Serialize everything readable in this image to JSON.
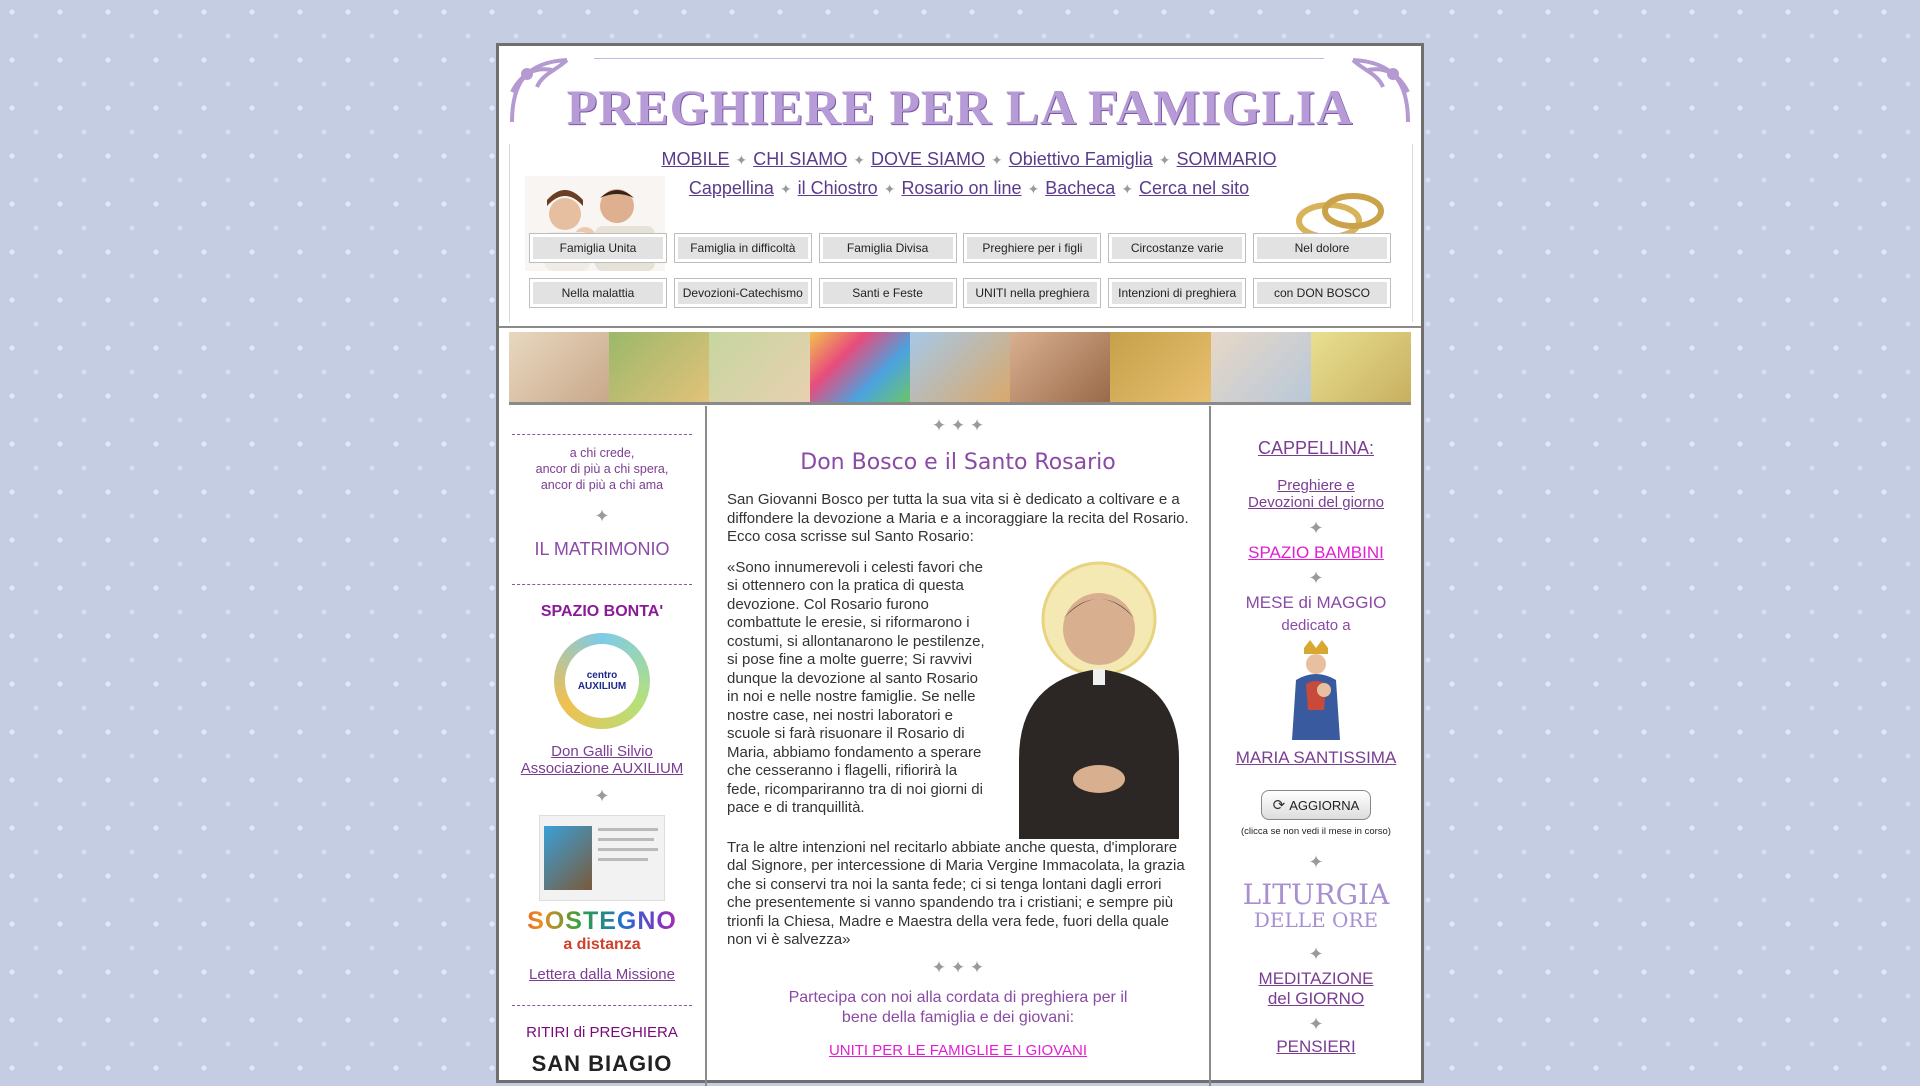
{
  "header": {
    "title": "PREGHIERE PER LA FAMIGLIA",
    "nav_row1": [
      "MOBILE",
      "CHI SIAMO",
      "DOVE SIAMO",
      "Obiettivo Famiglia",
      "SOMMARIO"
    ],
    "nav_row2": [
      "Cappellina",
      "il Chiostro",
      "Rosario on line",
      "Bacheca",
      "Cerca nel sito"
    ],
    "buttons_row1": [
      "Famiglia Unita",
      "Famiglia in difficoltà",
      "Famiglia Divisa",
      "Preghiere per i figli",
      "Circostanze varie",
      "Nel dolore"
    ],
    "buttons_row2": [
      "Nella malattia",
      "Devozioni-Catechismo",
      "Santi e Feste",
      "UNITI nella preghiera",
      "Intenzioni di preghiera",
      "con DON BOSCO"
    ]
  },
  "left": {
    "quote": [
      "a chi crede,",
      "ancor di più a chi spera,",
      "ancor di più a chi ama"
    ],
    "matrimonio": "IL MATRIMONIO",
    "spazio_bonta": "SPAZIO BONTA'",
    "auxilium_logo_text": [
      "centro",
      "AUXILIUM"
    ],
    "auxilium_link": [
      "Don Galli Silvio",
      "Associazione AUXILIUM"
    ],
    "sostegno": "SOSTEGNO",
    "distanza": "a distanza",
    "lettera": "Lettera dalla Missione",
    "ritiri": "RITIRI di PREGHIERA",
    "san_biagio": "SAN BIAGIO"
  },
  "center": {
    "stars": "✦ ✦ ✦",
    "title": "Don Bosco e il Santo Rosario",
    "intro": "San Giovanni Bosco per tutta la sua vita si è dedicato a coltivare e a diffondere la devozione a Maria e a incoraggiare la recita del Rosario. Ecco cosa scrisse sul Santo Rosario:",
    "quote_part1": "«Sono innumerevoli i celesti favori che si ottennero con la pratica di questa devozione. Col Rosario furono combattute le eresie, si riformarono i costumi, si allontanarono le pestilenze, si pose fine a molte guerre; Si ravvivi dunque la devozione al santo Rosario in noi e nelle nostre famiglie. Se nelle nostre case, nei nostri laboratori e scuole si farà risuonare il Rosario di Maria, abbiamo fondamento a sperare che cesseranno i flagelli, rifiorirà la fede, ricompariranno tra di noi giorni di pace e di tranquillità.",
    "quote_part2": "Tra le altre intenzioni nel recitarlo abbiate anche questa, d'implorare dal Signore, per intercessione di Maria Vergine Immacolata, la grazia che si conservi tra noi la santa fede; ci si tenga lontani dagli errori che presentemente si vanno spandendo tra i cristiani; e sempre più trionfi la Chiesa, Madre e Maestra della vera fede, fuori della quale non vi è salvezza»",
    "partecipa": [
      "Partecipa con noi alla cordata di preghiera per il",
      "bene della famiglia e dei giovani:"
    ],
    "uniti_link": "UNITI PER LE FAMIGLIE E I GIOVANI"
  },
  "right": {
    "cappellina": "CAPPELLINA:",
    "preghiere": [
      "Preghiere e",
      "Devozioni del giorno"
    ],
    "spazio_bambini": "SPAZIO BAMBINI",
    "mese": "MESE di MAGGIO",
    "dedicato": "dedicato a",
    "maria": "MARIA SANTISSIMA",
    "aggiorna": "AGGIORNA",
    "aggiorna_note": "(clicca se non vedi il mese in corso)",
    "liturgia": [
      "LITURGIA",
      "DELLE ORE"
    ],
    "meditazione": [
      "MEDITAZIONE",
      "del GIORNO"
    ],
    "pensieri": "PENSIERI"
  },
  "colors": {
    "purple_text": "#7a3d92",
    "link_blue_purple": "#5b3c8c",
    "magenta": "#e01fd0"
  }
}
